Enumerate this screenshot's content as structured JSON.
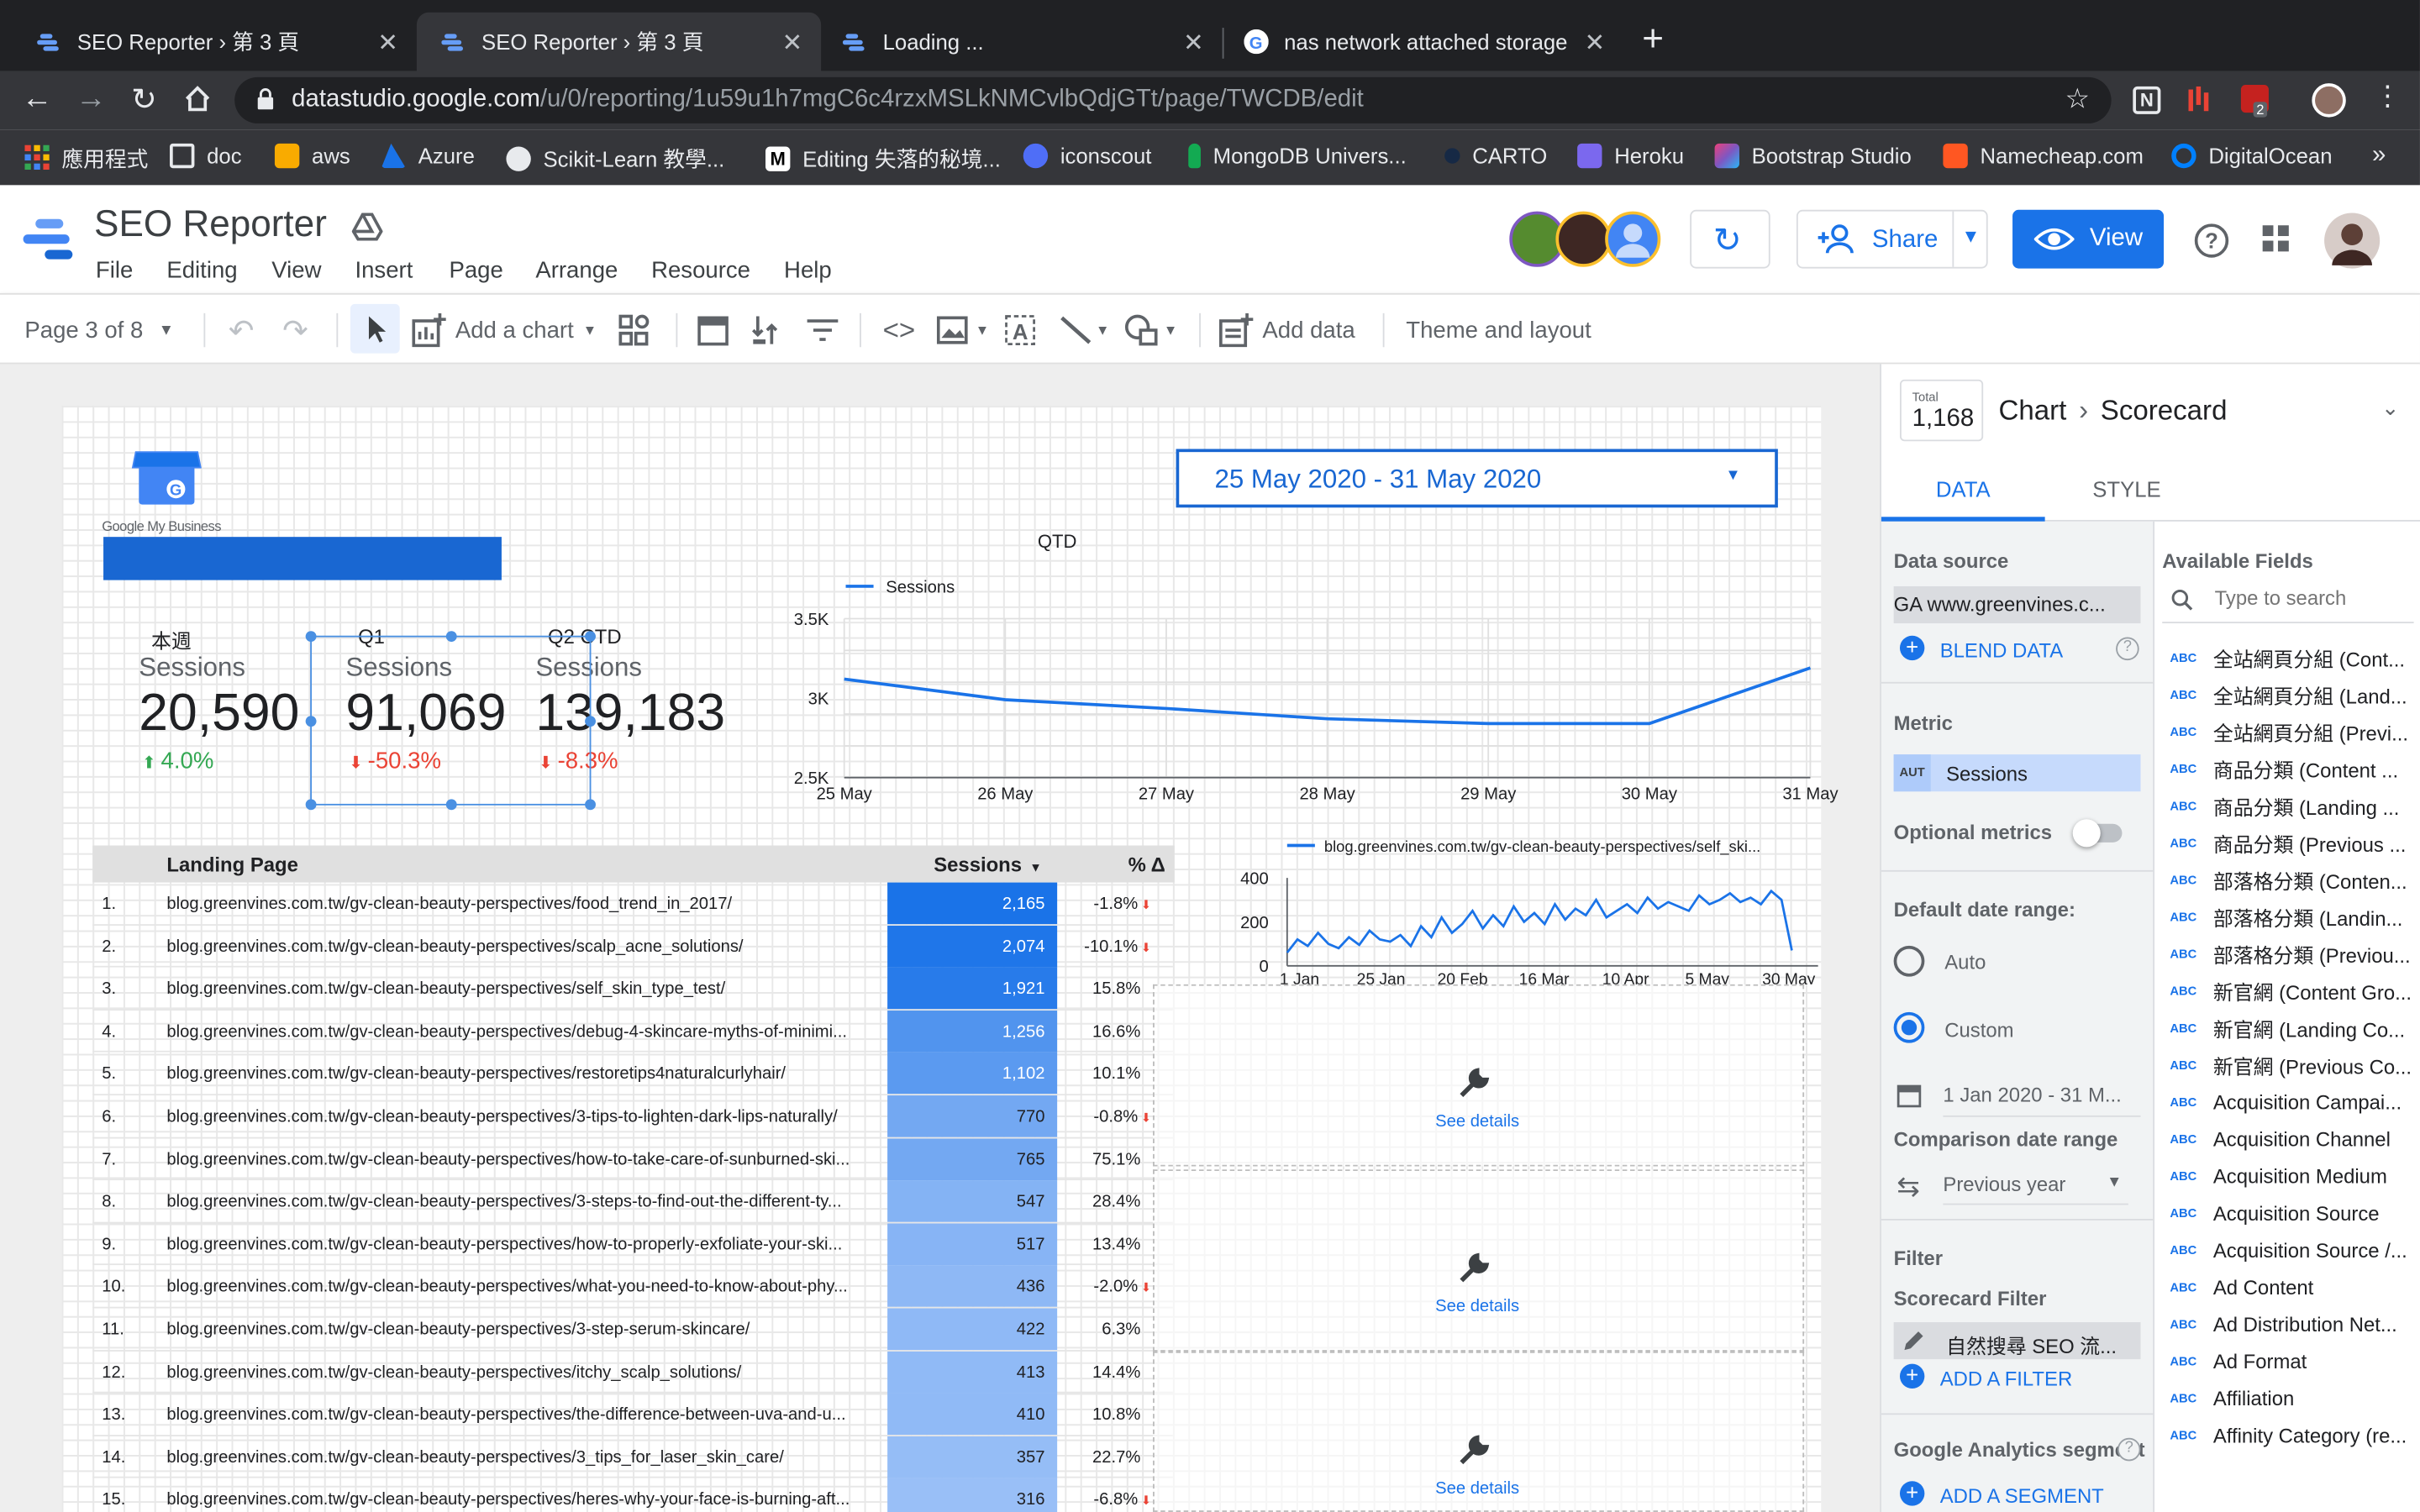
{
  "browser": {
    "tabs": [
      {
        "title": "SEO Reporter › 第 3 頁"
      },
      {
        "title": "SEO Reporter › 第 3 頁"
      },
      {
        "title": "Loading ..."
      },
      {
        "title": "nas network attached storage"
      }
    ],
    "url_host": "datastudio.google.com",
    "url_path": "/u/0/reporting/1u59u1h7mgC6c4rzxMSLkNMCvlbQdjGTt/page/TWCDB/edit",
    "bookmarks": [
      "應用程式",
      "doc",
      "aws",
      "Azure",
      "Scikit-Learn 教學...",
      "Editing 失落的秘境...",
      "iconscout",
      "MongoDB Univers...",
      "CARTO",
      "Heroku",
      "Bootstrap Studio",
      "Namecheap.com",
      "DigitalOcean"
    ],
    "ext_badge": "2"
  },
  "app": {
    "title": "SEO Reporter",
    "menu": [
      "File",
      "Editing",
      "View",
      "Insert",
      "Page",
      "Arrange",
      "Resource",
      "Help"
    ],
    "share": "Share",
    "view": "View"
  },
  "toolbar": {
    "page": "Page 3 of 8",
    "add_chart": "Add a chart",
    "add_data": "Add data",
    "theme": "Theme and layout"
  },
  "report": {
    "gmb_logo": "Google My Business",
    "date_range": "25 May 2020 - 31 May 2020",
    "scorecards": [
      {
        "period": "本週",
        "label": "Sessions",
        "value": "20,590",
        "delta": "4.0%",
        "dir": "up"
      },
      {
        "period": "Q1",
        "label": "Sessions",
        "value": "91,069",
        "delta": "-50.3%",
        "dir": "down"
      },
      {
        "period": "Q2 CTD",
        "label": "Sessions",
        "value": "139,183",
        "delta": "-8.3%",
        "dir": "down"
      }
    ],
    "qtd_title": "QTD",
    "see_details": "See details",
    "table": {
      "col_page": "Landing Page",
      "col_sessions": "Sessions",
      "col_delta": "% Δ",
      "rows": [
        {
          "n": "1.",
          "url": "blog.greenvines.com.tw/gv-clean-beauty-perspectives/food_trend_in_2017/",
          "s": "2,165",
          "d": "-1.8%"
        },
        {
          "n": "2.",
          "url": "blog.greenvines.com.tw/gv-clean-beauty-perspectives/scalp_acne_solutions/",
          "s": "2,074",
          "d": "-10.1%"
        },
        {
          "n": "3.",
          "url": "blog.greenvines.com.tw/gv-clean-beauty-perspectives/self_skin_type_test/",
          "s": "1,921",
          "d": "15.8%"
        },
        {
          "n": "4.",
          "url": "blog.greenvines.com.tw/gv-clean-beauty-perspectives/debug-4-skincare-myths-of-minimi...",
          "s": "1,256",
          "d": "16.6%"
        },
        {
          "n": "5.",
          "url": "blog.greenvines.com.tw/gv-clean-beauty-perspectives/restoretips4naturalcurlyhair/",
          "s": "1,102",
          "d": "10.1%"
        },
        {
          "n": "6.",
          "url": "blog.greenvines.com.tw/gv-clean-beauty-perspectives/3-tips-to-lighten-dark-lips-naturally/",
          "s": "770",
          "d": "-0.8%"
        },
        {
          "n": "7.",
          "url": "blog.greenvines.com.tw/gv-clean-beauty-perspectives/how-to-take-care-of-sunburned-ski...",
          "s": "765",
          "d": "75.1%"
        },
        {
          "n": "8.",
          "url": "blog.greenvines.com.tw/gv-clean-beauty-perspectives/3-steps-to-find-out-the-different-ty...",
          "s": "547",
          "d": "28.4%"
        },
        {
          "n": "9.",
          "url": "blog.greenvines.com.tw/gv-clean-beauty-perspectives/how-to-properly-exfoliate-your-ski...",
          "s": "517",
          "d": "13.4%"
        },
        {
          "n": "10.",
          "url": "blog.greenvines.com.tw/gv-clean-beauty-perspectives/what-you-need-to-know-about-phy...",
          "s": "436",
          "d": "-2.0%"
        },
        {
          "n": "11.",
          "url": "blog.greenvines.com.tw/gv-clean-beauty-perspectives/3-step-serum-skincare/",
          "s": "422",
          "d": "6.3%"
        },
        {
          "n": "12.",
          "url": "blog.greenvines.com.tw/gv-clean-beauty-perspectives/itchy_scalp_solutions/",
          "s": "413",
          "d": "14.4%"
        },
        {
          "n": "13.",
          "url": "blog.greenvines.com.tw/gv-clean-beauty-perspectives/the-difference-between-uva-and-u...",
          "s": "410",
          "d": "10.8%"
        },
        {
          "n": "14.",
          "url": "blog.greenvines.com.tw/gv-clean-beauty-perspectives/3_tips_for_laser_skin_care/",
          "s": "357",
          "d": "22.7%"
        },
        {
          "n": "15.",
          "url": "blog.greenvines.com.tw/gv-clean-beauty-perspectives/heres-why-your-face-is-burning-aft...",
          "s": "316",
          "d": "-6.8%"
        }
      ]
    }
  },
  "chart_data": [
    {
      "type": "line",
      "title": "QTD",
      "series": [
        {
          "name": "Sessions",
          "values": [
            3120,
            2990,
            2935,
            2870,
            2840,
            2840,
            3190
          ]
        }
      ],
      "x": [
        "25 May",
        "26 May",
        "27 May",
        "28 May",
        "29 May",
        "30 May",
        "31 May"
      ],
      "yticks": [
        "3.5K",
        "3K",
        "2.5K"
      ],
      "ylim": [
        2500,
        3500
      ]
    },
    {
      "type": "line",
      "series": [
        {
          "name": "blog.greenvines.com.tw/gv-clean-beauty-perspectives/self_ski...",
          "values": [
            60,
            120,
            90,
            150,
            100,
            80,
            130,
            95,
            160,
            120,
            110,
            140,
            90,
            180,
            130,
            220,
            150,
            190,
            250,
            170,
            230,
            180,
            270,
            200,
            240,
            190,
            280,
            210,
            260,
            230,
            300,
            220,
            250,
            280,
            240,
            310,
            260,
            290,
            270,
            250,
            320,
            280,
            300,
            330,
            290,
            310,
            280,
            340,
            300,
            70
          ]
        }
      ],
      "x": [
        "1 Jan",
        "25 Jan",
        "20 Feb",
        "16 Mar",
        "10 Apr",
        "5 May",
        "30 May"
      ],
      "yticks": [
        "400",
        "200",
        "0"
      ],
      "ylim": [
        0,
        400
      ]
    }
  ],
  "panel": {
    "total_label": "Total",
    "total_val": "1,168",
    "crumb_a": "Chart",
    "crumb_b": "Scorecard",
    "tab_data": "DATA",
    "tab_style": "STYLE",
    "data_source_lbl": "Data source",
    "data_source": "GA www.greenvines.c...",
    "blend": "BLEND DATA",
    "metric_lbl": "Metric",
    "metric_tag": "AUT",
    "metric": "Sessions",
    "optional": "Optional metrics",
    "date_lbl": "Default date range:",
    "auto": "Auto",
    "custom": "Custom",
    "date_val": "1 Jan 2020 - 31 M...",
    "cmp_lbl": "Comparison date range",
    "cmp_val": "Previous year",
    "filter_lbl": "Filter",
    "sc_filter": "Scorecard Filter",
    "filter_val": "自然搜尋 SEO 流...",
    "add_filter": "ADD A FILTER",
    "seg_lbl": "Google Analytics segment",
    "add_seg": "ADD A SEGMENT",
    "avail_lbl": "Available Fields",
    "search_ph": "Type to search",
    "fields": [
      "全站網頁分組 (Cont...",
      "全站網頁分組 (Land...",
      "全站網頁分組 (Previ...",
      "商品分類 (Content ...",
      "商品分類 (Landing ...",
      "商品分類 (Previous ...",
      "部落格分類 (Conten...",
      "部落格分類 (Landin...",
      "部落格分類 (Previou...",
      "新官網 (Content Gro...",
      "新官網 (Landing Co...",
      "新官網 (Previous Co...",
      "Acquisition Campai...",
      "Acquisition Channel",
      "Acquisition Medium",
      "Acquisition Source",
      "Acquisition Source /...",
      "Ad Content",
      "Ad Distribution Net...",
      "Ad Format",
      "Affiliation",
      "Affinity Category (re..."
    ],
    "abc": "ABC"
  }
}
